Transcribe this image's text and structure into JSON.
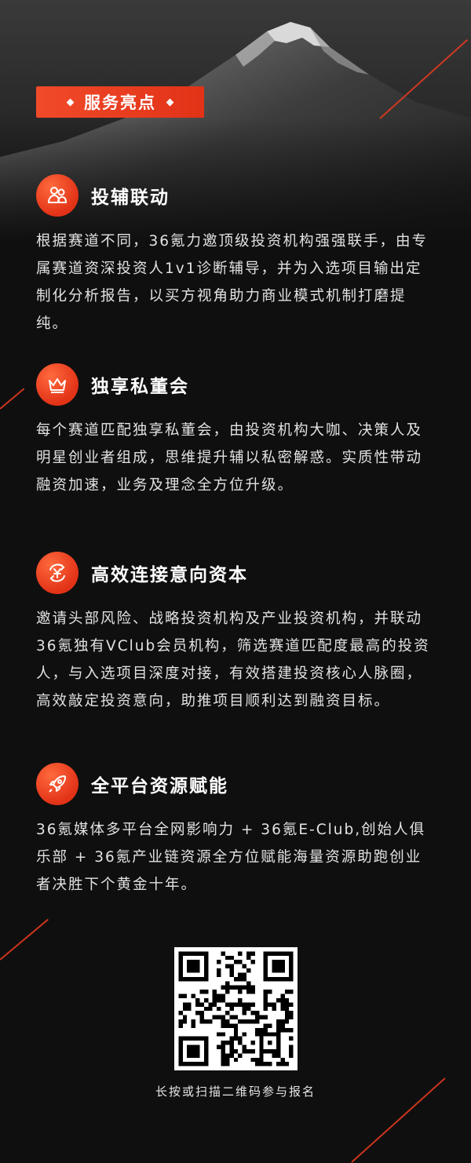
{
  "header": {
    "tag_label": "服务亮点"
  },
  "features": [
    {
      "icon": "people-icon",
      "title": "投辅联动",
      "body": "根据赛道不同，36氪力邀顶级投资机构强强联手，由专属赛道资深投资人1v1诊断辅导，并为入选项目输出定制化分析报告，以买方视角助力商业模式机制打磨提纯。"
    },
    {
      "icon": "crown-icon",
      "title": "独享私董会",
      "body": "每个赛道匹配独享私董会，由投资机构大咖、决策人及明星创业者组成，思维提升辅以私密解惑。实质性带动融资加速，业务及理念全方位升级。"
    },
    {
      "icon": "yuan-cycle-icon",
      "title": "高效连接意向资本",
      "body": "邀请头部风险、战略投资机构及产业投资机构，并联动36氪独有VClub会员机构，筛选赛道匹配度最高的投资人，与入选项目深度对接，有效搭建投资核心人脉圈，高效敲定投资意向，助推项目顺利达到融资目标。"
    },
    {
      "icon": "rocket-icon",
      "title": "全平台资源赋能",
      "body": "36氪媒体多平台全网影响力 + 36氪E-Club,创始人俱乐部 + 36氪产业链资源全方位赋能海量资源助跑创业者决胜下个黄金十年。"
    }
  ],
  "qr": {
    "caption": "长按或扫描二维码参与报名"
  },
  "colors": {
    "accent": "#e23217",
    "background": "#0f0f0f"
  }
}
